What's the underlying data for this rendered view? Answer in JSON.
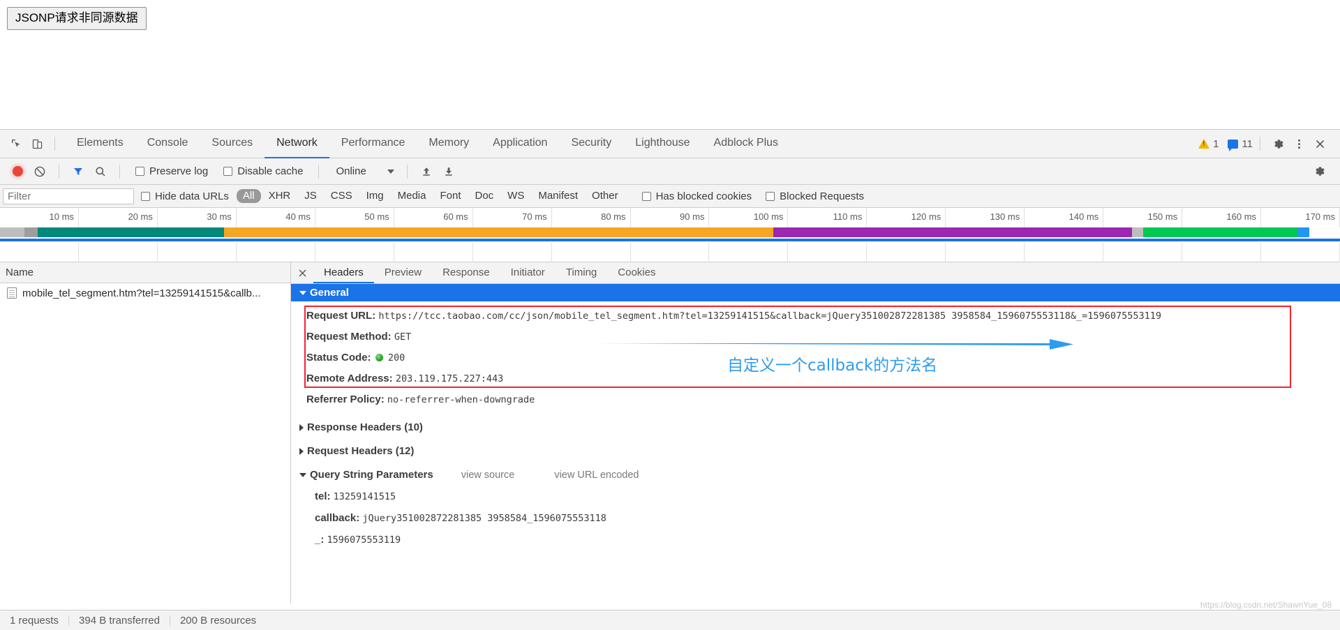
{
  "page": {
    "button_label": "JSONP请求非同源数据"
  },
  "devtools": {
    "inspect_icon": "inspect-element-icon",
    "device_icon": "toggle-device-toolbar-icon",
    "tabs": [
      {
        "label": "Elements",
        "active": false
      },
      {
        "label": "Console",
        "active": false
      },
      {
        "label": "Sources",
        "active": false
      },
      {
        "label": "Network",
        "active": true
      },
      {
        "label": "Performance",
        "active": false
      },
      {
        "label": "Memory",
        "active": false
      },
      {
        "label": "Application",
        "active": false
      },
      {
        "label": "Security",
        "active": false
      },
      {
        "label": "Lighthouse",
        "active": false
      },
      {
        "label": "Adblock Plus",
        "active": false
      }
    ],
    "status": {
      "warning_icon": "warning-triangle-icon",
      "warning_count": "1",
      "message_icon": "message-bubble-icon",
      "message_count": "11",
      "settings_icon": "gear-icon",
      "more_icon": "kebab-menu-icon",
      "close_icon": "close-icon"
    }
  },
  "network_toolbar": {
    "record_icon": "record-button-icon",
    "clear_icon": "clear-icon",
    "filter_icon": "filter-funnel-icon",
    "search_icon": "search-icon",
    "preserve_log": {
      "label": "Preserve log",
      "checked": false
    },
    "disable_cache": {
      "label": "Disable cache",
      "checked": false
    },
    "throttle": {
      "value": "Online",
      "caret_icon": "chevron-down-icon"
    },
    "import_icon": "import-har-icon",
    "export_icon": "export-har-icon",
    "settings_icon": "network-settings-gear-icon"
  },
  "filter_row": {
    "filter_placeholder": "Filter",
    "filter_value": "",
    "hide_data_urls": {
      "label": "Hide data URLs",
      "checked": false
    },
    "types": [
      {
        "label": "All",
        "selected": true
      },
      {
        "label": "XHR",
        "selected": false
      },
      {
        "label": "JS",
        "selected": false
      },
      {
        "label": "CSS",
        "selected": false
      },
      {
        "label": "Img",
        "selected": false
      },
      {
        "label": "Media",
        "selected": false
      },
      {
        "label": "Font",
        "selected": false
      },
      {
        "label": "Doc",
        "selected": false
      },
      {
        "label": "WS",
        "selected": false
      },
      {
        "label": "Manifest",
        "selected": false
      },
      {
        "label": "Other",
        "selected": false
      }
    ],
    "has_blocked_cookies": {
      "label": "Has blocked cookies",
      "checked": false
    },
    "blocked_requests": {
      "label": "Blocked Requests",
      "checked": false
    }
  },
  "overview": {
    "ticks": [
      "10 ms",
      "20 ms",
      "30 ms",
      "40 ms",
      "50 ms",
      "60 ms",
      "70 ms",
      "80 ms",
      "90 ms",
      "100 ms",
      "110 ms",
      "120 ms",
      "130 ms",
      "140 ms",
      "150 ms",
      "160 ms",
      "170 ms"
    ],
    "segments": [
      {
        "color": "#bdbdbd",
        "start_pct": 0.0,
        "width_pct": 1.8
      },
      {
        "color": "#9e9e9e",
        "start_pct": 1.8,
        "width_pct": 1.0
      },
      {
        "color": "#00897b",
        "start_pct": 2.8,
        "width_pct": 13.9
      },
      {
        "color": "#f5a623",
        "start_pct": 16.7,
        "width_pct": 41.0
      },
      {
        "color": "#9c27b0",
        "start_pct": 57.7,
        "width_pct": 26.8
      },
      {
        "color": "#bdbdbd",
        "start_pct": 84.5,
        "width_pct": 0.8
      },
      {
        "color": "#00c853",
        "start_pct": 85.3,
        "width_pct": 11.5
      },
      {
        "color": "#2196f3",
        "start_pct": 96.8,
        "width_pct": 0.9
      }
    ],
    "baseline_color": "#1a73e8"
  },
  "request_list": {
    "column_header": "Name",
    "rows": [
      {
        "icon": "document-icon",
        "name": "mobile_tel_segment.htm?tel=13259141515&callb..."
      }
    ]
  },
  "detail": {
    "close_icon": "close-icon",
    "tabs": [
      {
        "label": "Headers",
        "active": true
      },
      {
        "label": "Preview",
        "active": false
      },
      {
        "label": "Response",
        "active": false
      },
      {
        "label": "Initiator",
        "active": false
      },
      {
        "label": "Timing",
        "active": false
      },
      {
        "label": "Cookies",
        "active": false
      }
    ],
    "general": {
      "title": "General",
      "expanded": true,
      "request_url_label": "Request URL:",
      "request_url_value": "https://tcc.taobao.com/cc/json/mobile_tel_segment.htm?tel=13259141515&callback=jQuery351002872281385 3958584_1596075553118&_=1596075553119",
      "request_method_label": "Request Method:",
      "request_method_value": "GET",
      "status_code_label": "Status Code:",
      "status_code_value": "200",
      "status_indicator": "green-status-dot",
      "remote_address_label": "Remote Address:",
      "remote_address_value": "203.119.175.227:443",
      "referrer_policy_label": "Referrer Policy:",
      "referrer_policy_value": "no-referrer-when-downgrade"
    },
    "response_headers": {
      "label": "Response Headers (10)",
      "expanded": false
    },
    "request_headers": {
      "label": "Request Headers (12)",
      "expanded": false
    },
    "query_string": {
      "label": "Query String Parameters",
      "expanded": true,
      "view_source": "view source",
      "view_url_encoded": "view URL encoded",
      "params": [
        {
          "key": "tel:",
          "value": "13259141515"
        },
        {
          "key": "callback:",
          "value": "jQuery351002872281385 3958584_1596075553118"
        },
        {
          "key": "_:",
          "value": "1596075553119"
        }
      ]
    }
  },
  "annotations": {
    "callback_note": "自定义一个callback的方法名",
    "highlight_color": "#f5222d",
    "note_color": "#2d9cf0",
    "arrow_color": "#2d9cf0"
  },
  "statusbar": {
    "requests": "1 requests",
    "transferred": "394 B transferred",
    "resources": "200 B resources"
  },
  "watermark": "https://blog.csdn.net/ShawnYue_08"
}
